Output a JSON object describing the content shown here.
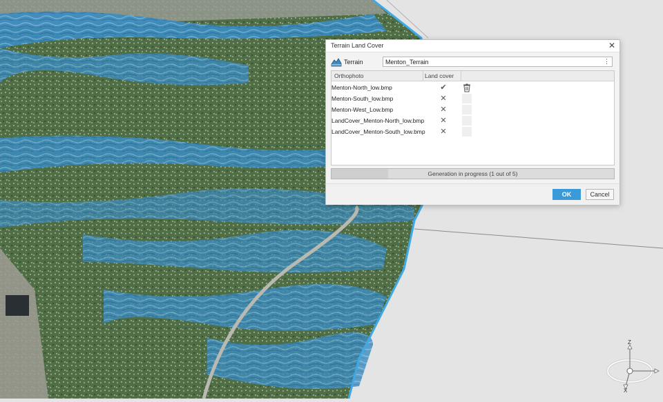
{
  "dialog": {
    "title": "Terrain Land Cover",
    "close_icon": "close-icon",
    "terrain_label": "Terrain",
    "terrain_icon": "terrain-icon",
    "terrain_value": "Menton_Terrain",
    "columns": [
      "Orthophoto",
      "Land cover"
    ],
    "rows": [
      {
        "name": "Menton-North_low.bmp",
        "land_cover": "done",
        "mark": "✔",
        "delete_icon": "trash-icon"
      },
      {
        "name": "Menton-South_low.bmp",
        "land_cover": "pending",
        "mark": "✕"
      },
      {
        "name": "Menton-West_Low.bmp",
        "land_cover": "pending",
        "mark": "✕"
      },
      {
        "name": "LandCover_Menton-North_low.bmp",
        "land_cover": "pending",
        "mark": "✕"
      },
      {
        "name": "LandCover_Menton-South_low.bmp",
        "land_cover": "pending",
        "mark": "✕"
      }
    ],
    "progress_text": "Generation in progress (1 out of 5)",
    "progress_fraction": 0.2,
    "ok_label": "OK",
    "cancel_label": "Cancel",
    "accent_color": "#3a9ad9"
  },
  "viewport": {
    "terrain_water_color": "#3d8fc4",
    "background_color": "#e4e4e4"
  },
  "gizmo": {
    "icon": "navigation-gizmo-icon",
    "axis_z": "Z",
    "axis_x": "X"
  }
}
